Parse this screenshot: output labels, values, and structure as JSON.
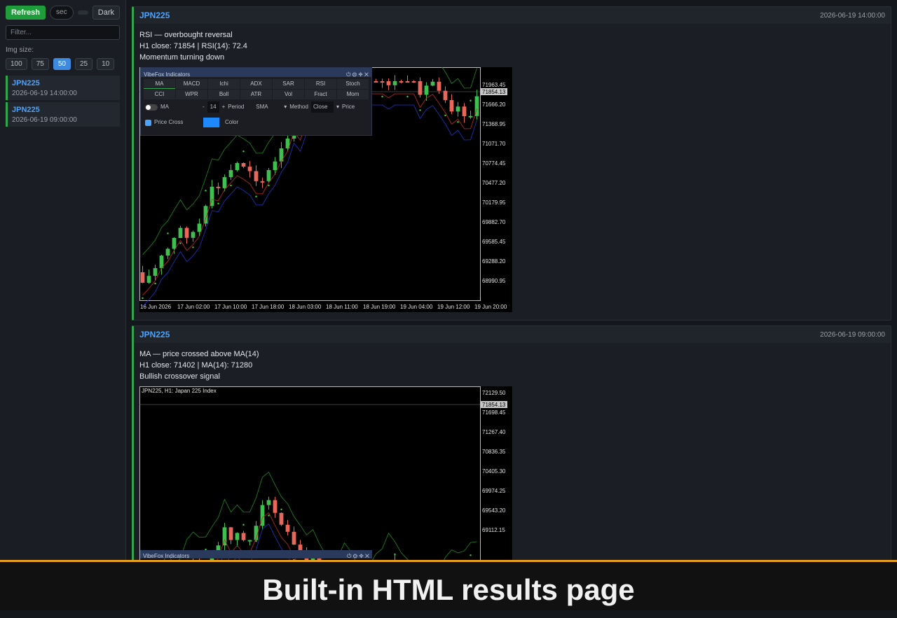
{
  "sidebar": {
    "refresh_label": "Refresh",
    "sec_placeholder": "sec",
    "dark_label": "Dark",
    "filter_placeholder": "Filter...",
    "img_size_label": "Img size:",
    "sizes": [
      "100",
      "75",
      "50",
      "25",
      "10"
    ],
    "active_size": "50",
    "signals": [
      {
        "symbol": "JPN225",
        "date": "2026-06-19 14:00:00"
      },
      {
        "symbol": "JPN225",
        "date": "2026-06-19 09:00:00"
      }
    ]
  },
  "cards": [
    {
      "symbol": "JPN225",
      "date": "2026-06-19 14:00:00",
      "line1": "RSI — overbought reversal",
      "line2": "H1 close: 71854 | RSI(14): 72.4",
      "line3": "Momentum turning down",
      "chart": {
        "prices": [
          "71963.45",
          "71666.20",
          "71368.95",
          "71071.70",
          "70774.45",
          "70477.20",
          "70179.95",
          "69882.70",
          "69585.45",
          "69288.20",
          "68990.95"
        ],
        "current_price": "71854.13",
        "times": [
          "16 Jun 2026",
          "17 Jun 02:00",
          "17 Jun 10:00",
          "17 Jun 18:00",
          "18 Jun 03:00",
          "18 Jun 11:00",
          "18 Jun 19:00",
          "19 Jun 04:00",
          "19 Jun 12:00",
          "19 Jun 20:00"
        ]
      },
      "panel": {
        "title": "VibeFox Indicators",
        "tabs": [
          "MA",
          "MACD",
          "Ichi",
          "ADX",
          "SAR",
          "RSI",
          "Stoch",
          "CCI",
          "WPR",
          "Boll",
          "ATR",
          "Vol",
          "Fract",
          "Mom"
        ],
        "ma_label": "MA",
        "period_value": "14",
        "period_label": "Period",
        "method_value": "SMA",
        "method_label": "Method",
        "price_value": "Close",
        "price_label": "Price",
        "price_cross_label": "Price Cross",
        "color_label": "Color"
      }
    },
    {
      "symbol": "JPN225",
      "date": "2026-06-19 09:00:00",
      "line1": "MA — price crossed above MA(14)",
      "line2": "H1 close: 71402 | MA(14): 71280",
      "line3": "Bullish crossover signal",
      "chart": {
        "header": "JPN225, H1:  Japan 225 Index",
        "prices": [
          "72129.50",
          "71698.45",
          "71267.40",
          "70836.35",
          "70405.30",
          "69974.25",
          "69543.20",
          "69112.15"
        ],
        "current_price": "71854.13",
        "panel_title": "VibeFox Indicators"
      }
    }
  ],
  "footer": {
    "caption": "Built-in HTML results page"
  },
  "colors": {
    "accent_green": "#2ea84a",
    "accent_blue": "#4aa3ff",
    "bull": "#3fbf4f",
    "bear": "#e8675a"
  }
}
